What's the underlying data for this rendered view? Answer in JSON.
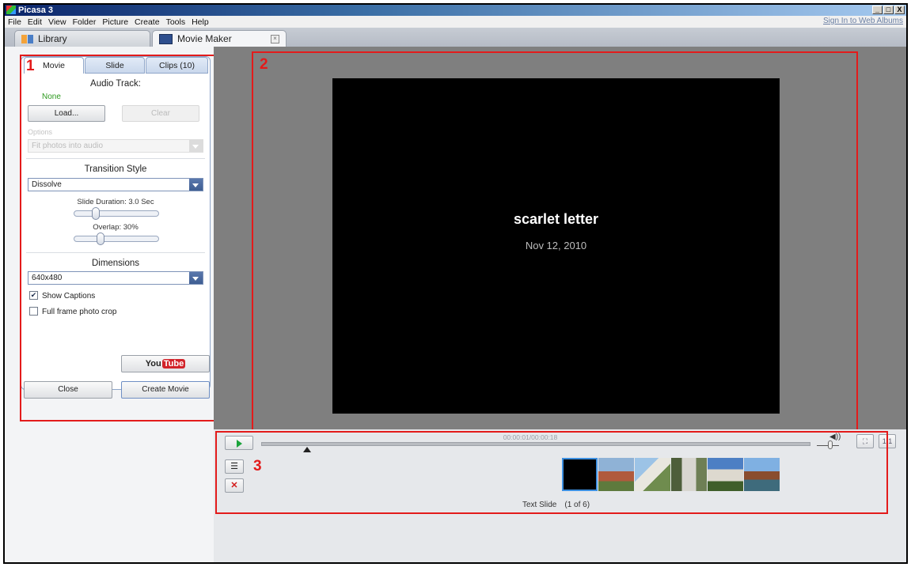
{
  "window": {
    "title": "Picasa 3",
    "controls": {
      "minimize": "_",
      "maximize": "□",
      "close": "X"
    }
  },
  "menubar": {
    "items": [
      "File",
      "Edit",
      "View",
      "Folder",
      "Picture",
      "Create",
      "Tools",
      "Help"
    ],
    "sign_in": "Sign In to Web Albums"
  },
  "tabs": {
    "library": "Library",
    "movie_maker": "Movie Maker"
  },
  "annotations": {
    "one": "1",
    "two": "2",
    "three": "3"
  },
  "panel": {
    "tabs": {
      "movie": "Movie",
      "slide": "Slide",
      "clips": "Clips (10)"
    },
    "audio_track_label": "Audio Track:",
    "audio_track_value": "None",
    "load_button": "Load...",
    "clear_button": "Clear",
    "options_label": "Options",
    "options_value": "Fit photos into audio",
    "transition_label": "Transition Style",
    "transition_value": "Dissolve",
    "slide_duration": "Slide Duration: 3.0 Sec",
    "overlap": "Overlap: 30%",
    "dimensions_label": "Dimensions",
    "dimensions_value": "640x480",
    "show_captions": "Show Captions",
    "show_captions_checked": true,
    "full_frame": "Full frame photo crop",
    "full_frame_checked": false,
    "youtube_you": "You",
    "youtube_tube": "Tube",
    "close_button": "Close",
    "create_button": "Create Movie"
  },
  "preview": {
    "title": "scarlet letter",
    "date": "Nov 12, 2010"
  },
  "player": {
    "timecode": "00:00:01/00:00:18",
    "status_type": "Text Slide",
    "status_count": "(1 of 6)"
  },
  "colors": {
    "annotation_red": "#e31b1b",
    "audio_none_green": "#2d9a1f",
    "youtube_red": "#d2232a"
  }
}
